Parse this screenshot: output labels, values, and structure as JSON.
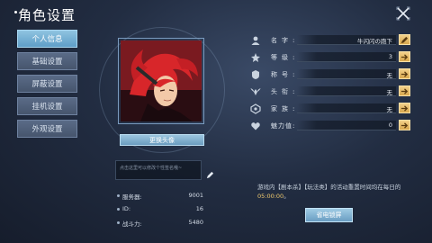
{
  "header": {
    "title": "角色设置"
  },
  "sidebar": {
    "items": [
      {
        "label": "个人信息"
      },
      {
        "label": "基础设置"
      },
      {
        "label": "屏蔽设置"
      },
      {
        "label": "挂机设置"
      },
      {
        "label": "外观设置"
      }
    ]
  },
  "profile": {
    "change_avatar_label": "更换头像",
    "signature_placeholder": "点击这里可以修改个性签名哦~",
    "stats": [
      {
        "label": "服务器:",
        "value": "9001"
      },
      {
        "label": "ID:",
        "value": "16"
      },
      {
        "label": "战斗力:",
        "value": "5480"
      }
    ]
  },
  "info": {
    "rows": [
      {
        "label": "名字:",
        "value": "牛闪闪の跑下",
        "icon": "person-icon",
        "button": "edit"
      },
      {
        "label": "等级:",
        "value": "3",
        "icon": "level-star-icon",
        "button": "arrow"
      },
      {
        "label": "称号:",
        "value": "无",
        "icon": "title-crest-icon",
        "button": "arrow"
      },
      {
        "label": "头衔:",
        "value": "无",
        "icon": "rank-wings-icon",
        "button": "arrow"
      },
      {
        "label": "家族:",
        "value": "无",
        "icon": "family-emblem-icon",
        "button": "arrow"
      },
      {
        "label": "魅力值:",
        "value": "0",
        "icon": "charm-heart-icon",
        "button": "arrow"
      }
    ]
  },
  "notice": {
    "text": "游戏内【剧本杀】【玩法类】的活动重置时间均在每日的",
    "time": "05:00:00",
    "suffix": "。"
  },
  "lock_button_label": "省电锁屏",
  "colors": {
    "accent_gold": "#f1cc6f",
    "active_tab": "#6aa8d0"
  }
}
